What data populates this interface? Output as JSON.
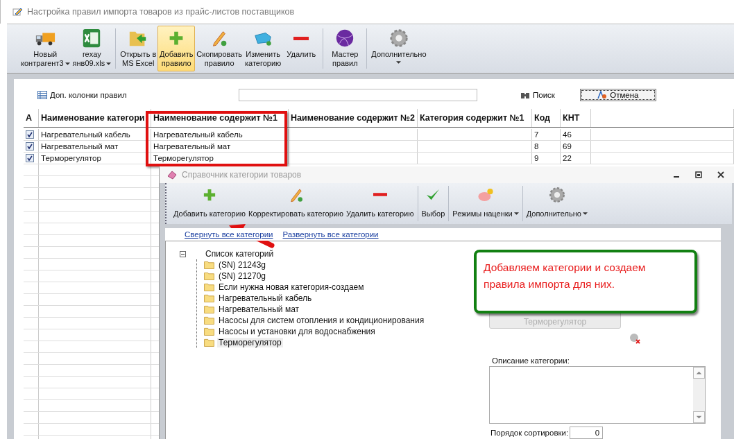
{
  "window": {
    "title": "Настройка правил импорта товаров из прайс-листов поставщиков"
  },
  "toolbar": [
    {
      "items": [
        {
          "kind": "truck",
          "lines": [
            "Новый",
            "контрагент3"
          ],
          "dropdown": true,
          "selected": false
        },
        {
          "kind": "excel",
          "lines": [
            "rexay",
            "янв09.xls"
          ],
          "dropdown": true,
          "selected": false
        }
      ]
    },
    {
      "items": [
        {
          "kind": "folder",
          "lines": [
            "Открыть в",
            "MS Excel"
          ],
          "dropdown": false,
          "selected": false
        },
        {
          "kind": "plus",
          "lines": [
            "Добавить",
            "правило"
          ],
          "dropdown": false,
          "selected": true
        },
        {
          "kind": "pencil",
          "lines": [
            "Скопировать",
            "правило"
          ],
          "dropdown": false,
          "selected": false
        },
        {
          "kind": "tag",
          "lines": [
            "Изменить",
            "категорию"
          ],
          "dropdown": false,
          "selected": false
        },
        {
          "kind": "minus",
          "lines": [
            "Удалить"
          ],
          "dropdown": false,
          "selected": false
        }
      ]
    },
    {
      "items": [
        {
          "kind": "globe",
          "lines": [
            "Мастер",
            "правил"
          ],
          "dropdown": false,
          "selected": false
        }
      ]
    },
    {
      "items": [
        {
          "kind": "gear",
          "lines": [
            "Дополнительно"
          ],
          "dropdown": true,
          "selected": false
        }
      ]
    }
  ],
  "filter": {
    "extra_columns": "Доп. колонки правил",
    "search_button": "Поиск",
    "cancel_button": "Отмена"
  },
  "grid": {
    "columns": [
      "A",
      "Наименование категори",
      "Наименование содержит №1",
      "Наименование содержит №2",
      "Категория содержит №1",
      "Код",
      "КНТ"
    ],
    "rows": [
      {
        "checked": true,
        "category": "Нагревательный кабель",
        "contains_1": "Нагревательный кабель",
        "code": "7",
        "knt": "46"
      },
      {
        "checked": true,
        "category": "Нагревательный мат",
        "contains_1": "Нагревательный мат",
        "code": "8",
        "knt": "69"
      },
      {
        "checked": true,
        "category": "Терморегулятор",
        "contains_1": "Терморегулятор",
        "code": "9",
        "knt": "22"
      }
    ]
  },
  "dialog": {
    "title": "Справочник категории товаров",
    "toolbar": [
      {
        "items": [
          {
            "kind": "plus",
            "label": "Добавить категорию",
            "dropdown": false
          },
          {
            "kind": "pencil",
            "label": "Корректировать категорию",
            "dropdown": false
          },
          {
            "kind": "minus",
            "label": "Удалить категорию",
            "dropdown": false
          }
        ]
      },
      {
        "items": [
          {
            "kind": "check",
            "label": "Выбор",
            "dropdown": false
          }
        ]
      },
      {
        "items": [
          {
            "kind": "piggy",
            "label": "Режимы наценки",
            "dropdown": true
          }
        ]
      },
      {
        "items": [
          {
            "kind": "gear",
            "label": "Дополнительно",
            "dropdown": true
          }
        ]
      }
    ],
    "links": [
      "Свернуть все категории",
      "Развернуть все категории"
    ],
    "tree": {
      "label": "Список категорий",
      "expanded": true,
      "children": [
        {
          "label": "(SN) 21243g",
          "selected": false
        },
        {
          "label": "(SN) 21270g",
          "selected": false
        },
        {
          "label": "Если нужна новая категория-создаем",
          "selected": false
        },
        {
          "label": "Нагревательный кабель",
          "selected": false
        },
        {
          "label": "Нагревательный мат",
          "selected": false
        },
        {
          "label": "Насосы для систем отопления и кондиционирования",
          "selected": false
        },
        {
          "label": "Насосы и установки для водоснабжения",
          "selected": false
        },
        {
          "label": "Терморегулятор",
          "selected": true
        }
      ]
    },
    "image_caption": "Терморегулятор",
    "description_label": "Описание категории:",
    "sort_label": "Порядок сортировки:",
    "sort_value": "0"
  },
  "callout": {
    "text": "Добавляем категории и создаем правила импорта для них."
  }
}
